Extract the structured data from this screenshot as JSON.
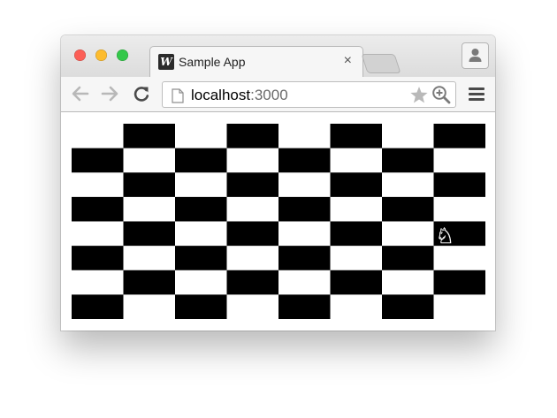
{
  "browser": {
    "tab": {
      "favicon_letter": "W",
      "title": "Sample App",
      "close_glyph": "×"
    },
    "address": {
      "host": "localhost",
      "port": ":3000"
    },
    "icons": {
      "back": "arrow-left-icon",
      "forward": "arrow-right-icon",
      "reload": "reload-icon",
      "page": "page-icon",
      "bookmark": "star-icon",
      "zoom": "zoom-in-icon",
      "menu": "hamburger-menu-icon",
      "profile": "person-icon"
    },
    "traffic_lights": {
      "close": "#fc5f57",
      "minimize": "#fdbc2e",
      "maximize": "#34c84a"
    }
  },
  "board": {
    "rows": 8,
    "cols": 8,
    "dark_color": "#000000",
    "light_color": "#ffffff",
    "first_square_dark": false,
    "pieces": [
      {
        "piece": "knight",
        "color": "white",
        "row": 4,
        "col": 7,
        "glyph": "♘"
      }
    ]
  }
}
